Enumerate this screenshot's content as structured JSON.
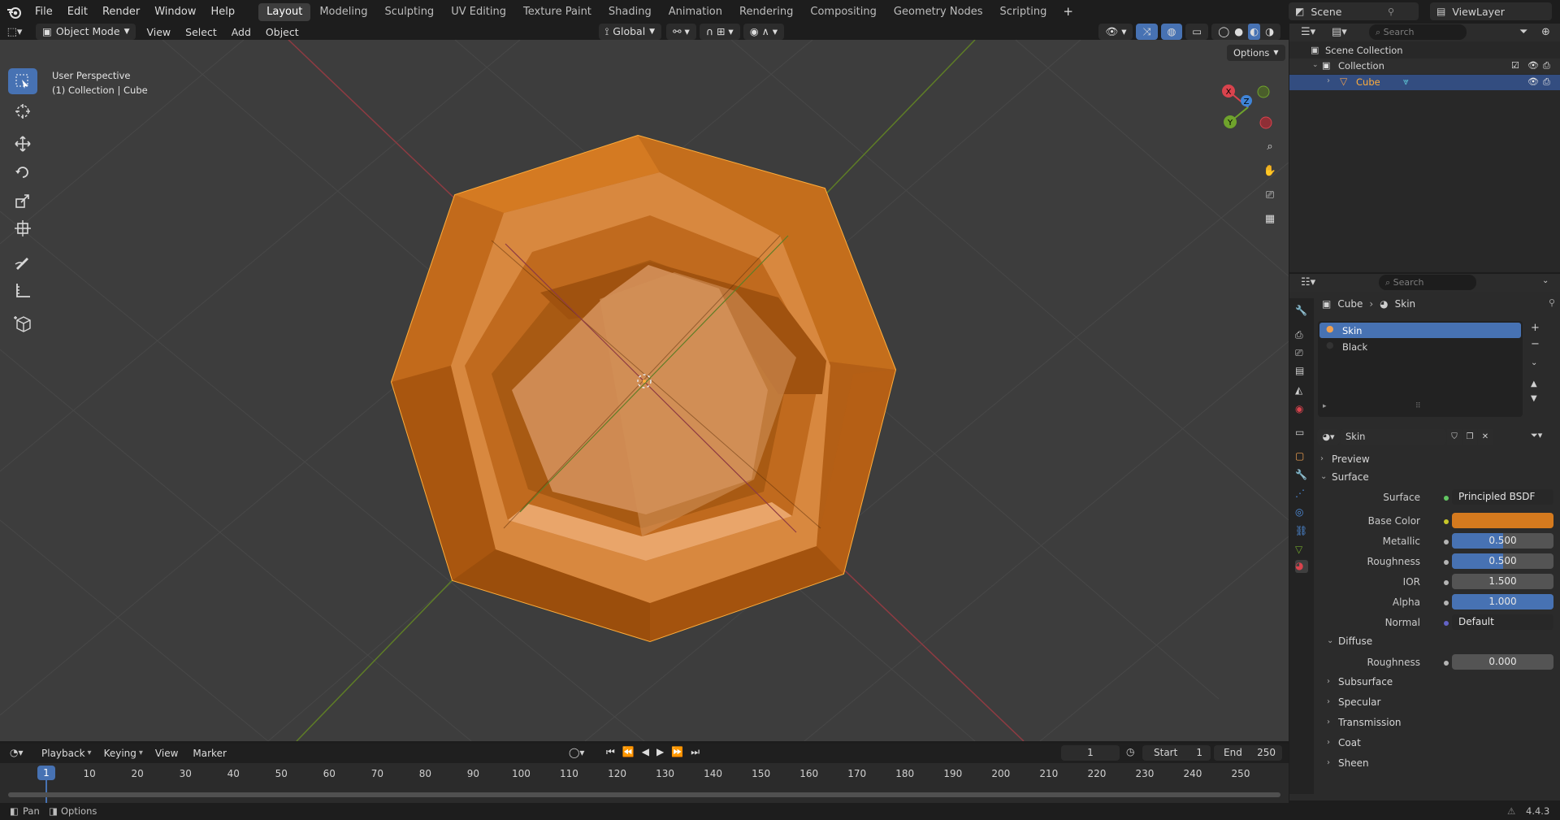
{
  "topbar": {
    "menus": [
      "File",
      "Edit",
      "Render",
      "Window",
      "Help"
    ],
    "workspaces": [
      "Layout",
      "Modeling",
      "Sculpting",
      "UV Editing",
      "Texture Paint",
      "Shading",
      "Animation",
      "Rendering",
      "Compositing",
      "Geometry Nodes",
      "Scripting"
    ],
    "active_workspace": "Layout",
    "add_tab": "+",
    "scene_label": "Scene",
    "viewlayer_label": "ViewLayer"
  },
  "viewport_header": {
    "mode": "Object Mode",
    "menus": [
      "View",
      "Select",
      "Add",
      "Object"
    ],
    "transform_orientation": "Global",
    "options_label": "Options"
  },
  "viewport": {
    "perspective_label": "User Perspective",
    "collection_label": "(1) Collection | Cube",
    "gizmo_axes": [
      "X",
      "Y",
      "Z"
    ],
    "object_color": "#d57a1e",
    "outline_color": "#ffae3c"
  },
  "toolbar": {
    "tools": [
      "select-box-icon",
      "cursor-icon",
      "move-icon",
      "rotate-icon",
      "scale-icon",
      "transform-icon",
      "annotate-icon",
      "measure-icon",
      "add-cube-icon"
    ]
  },
  "outliner": {
    "search_placeholder": "Search",
    "items": [
      {
        "label": "Scene Collection",
        "depth": 0
      },
      {
        "label": "Collection",
        "depth": 1
      },
      {
        "label": "Cube",
        "depth": 2,
        "selected": true
      }
    ]
  },
  "properties": {
    "search_placeholder": "Search",
    "breadcrumb_object": "Cube",
    "breadcrumb_material": "Skin",
    "material_slots": [
      {
        "label": "Skin",
        "active": true
      },
      {
        "label": "Black",
        "active": false
      }
    ],
    "material_name": "Skin",
    "sections": {
      "preview": "Preview",
      "surface": "Surface",
      "diffuse": "Diffuse",
      "subsurface": "Subsurface",
      "specular": "Specular",
      "transmission": "Transmission",
      "coat": "Coat",
      "sheen": "Sheen"
    },
    "fields": {
      "surface_label": "Surface",
      "surface_value": "Principled BSDF",
      "base_color_label": "Base Color",
      "base_color_value": "#d57a1e",
      "metallic_label": "Metallic",
      "metallic_value": "0.500",
      "metallic_fraction": 0.5,
      "roughness_label": "Roughness",
      "roughness_value": "0.500",
      "roughness_fraction": 0.5,
      "ior_label": "IOR",
      "ior_value": "1.500",
      "alpha_label": "Alpha",
      "alpha_value": "1.000",
      "alpha_fraction": 1.0,
      "normal_label": "Normal",
      "normal_value": "Default",
      "diffuse_roughness_label": "Roughness",
      "diffuse_roughness_value": "0.000"
    }
  },
  "timeline": {
    "menus": [
      "Playback",
      "Keying",
      "View",
      "Marker"
    ],
    "current_frame": "1",
    "start_label": "Start",
    "start_value": "1",
    "end_label": "End",
    "end_value": "250",
    "ruler": [
      "1",
      "10",
      "20",
      "30",
      "40",
      "50",
      "60",
      "70",
      "80",
      "90",
      "100",
      "110",
      "120",
      "130",
      "140",
      "150",
      "160",
      "170",
      "180",
      "190",
      "200",
      "210",
      "220",
      "230",
      "240",
      "250"
    ]
  },
  "statusbar": {
    "pan": "Pan",
    "options": "Options",
    "version": "4.4.3"
  },
  "colors": {
    "accent": "#4772b3",
    "x_axis": "#d9434d",
    "y_axis": "#6fa32c",
    "z_axis": "#3f84d8"
  }
}
